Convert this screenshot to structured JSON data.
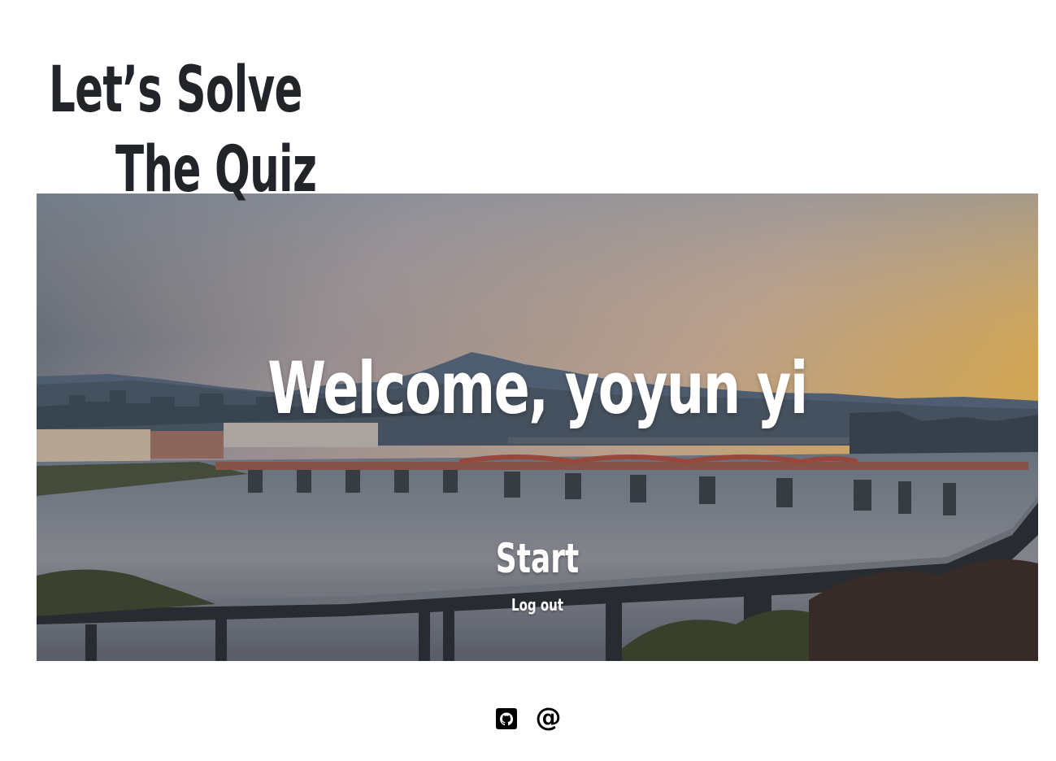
{
  "header": {
    "title_line1": "Let’s Solve",
    "title_line2": "The Quiz"
  },
  "hero": {
    "welcome_text": "Welcome, yoyun yi",
    "start_label": "Start",
    "logout_label": "Log out"
  },
  "footer": {
    "links": [
      {
        "icon": "github-icon"
      },
      {
        "icon": "at-icon",
        "glyph": "@"
      }
    ]
  },
  "colors": {
    "title_text": "#212529",
    "hero_text": "#ffffff",
    "page_background": "#ffffff"
  }
}
